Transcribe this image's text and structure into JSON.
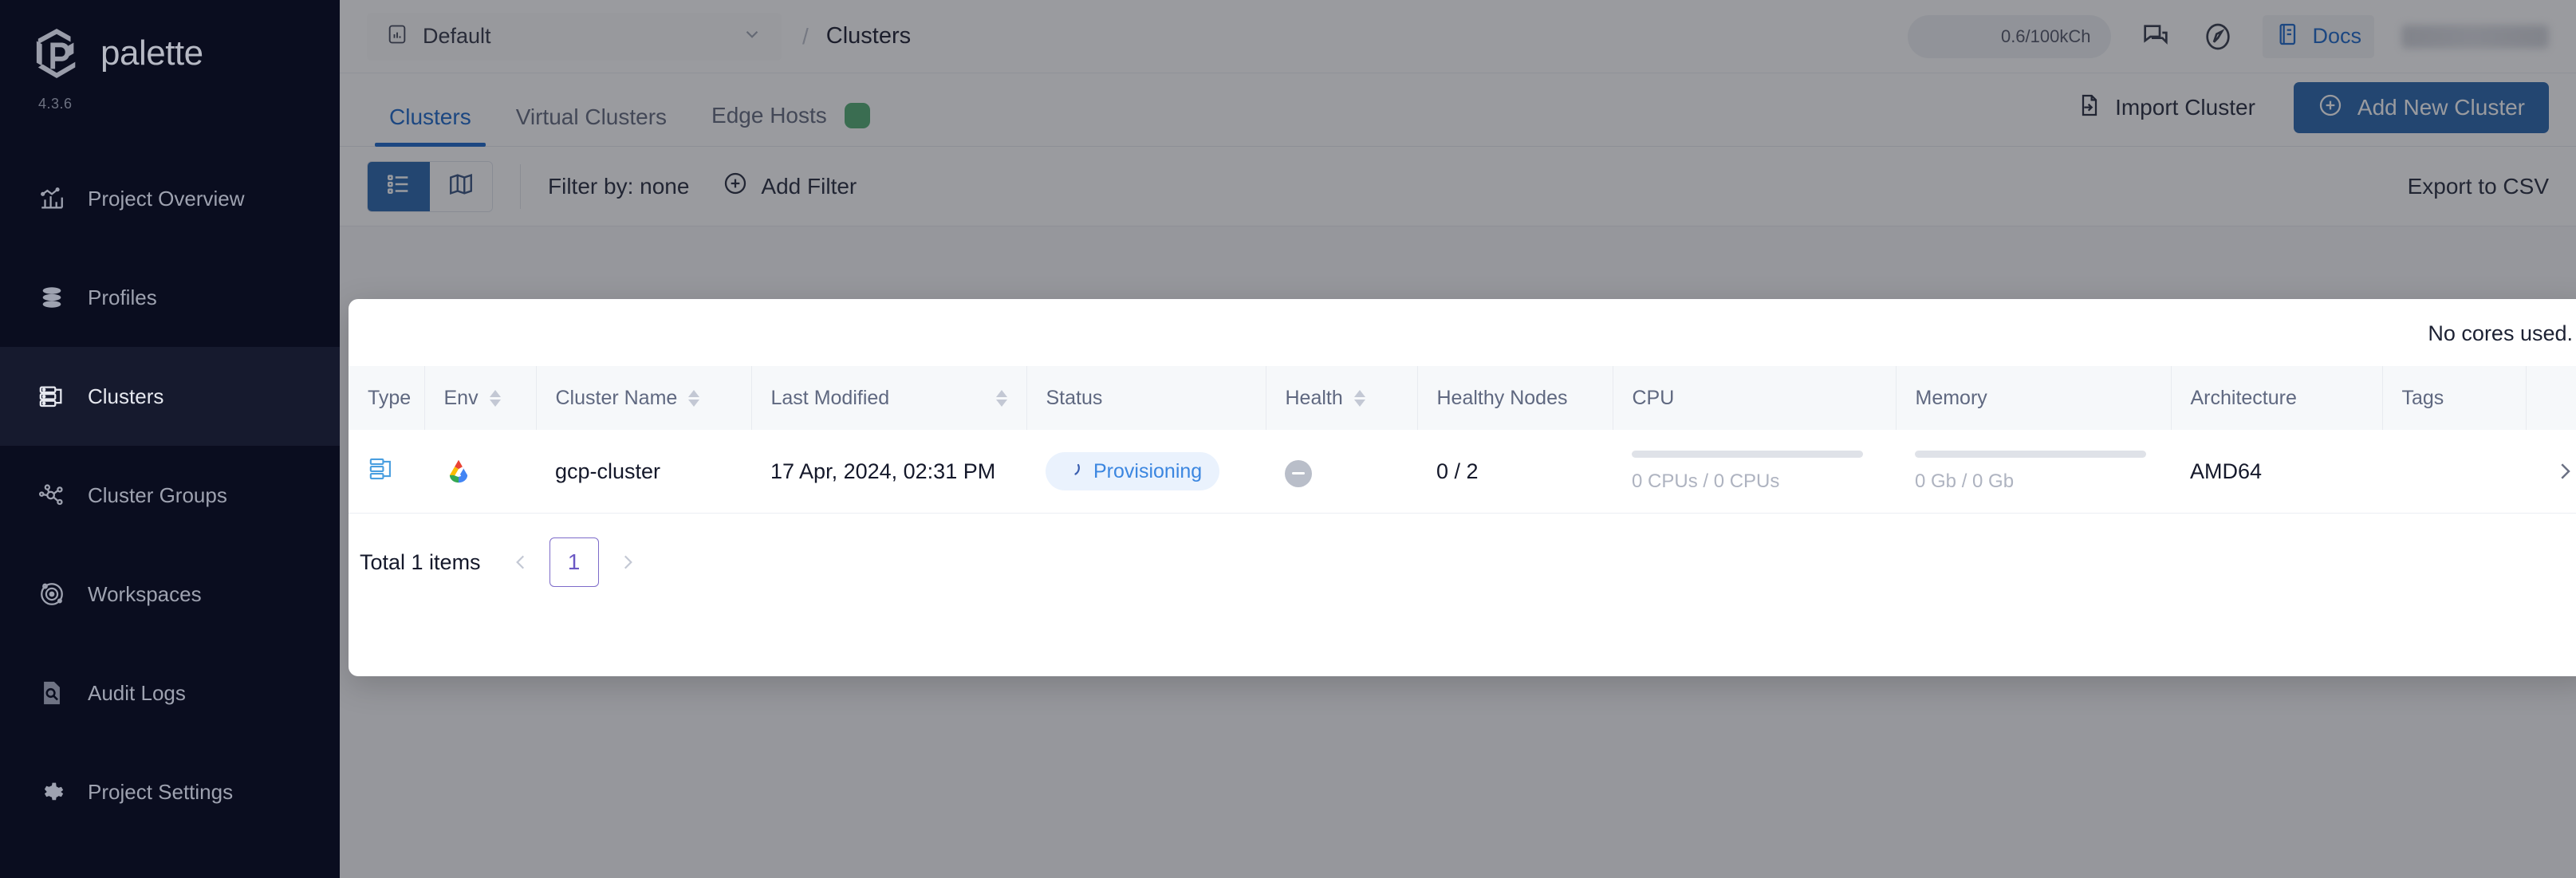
{
  "brand": {
    "name": "palette",
    "version": "4.3.6",
    "logo_icon": "palette-hexagon-logo"
  },
  "sidebar": {
    "items": [
      {
        "label": "Project Overview",
        "icon": "bar-chart-icon",
        "active": false
      },
      {
        "label": "Profiles",
        "icon": "layers-stack-icon",
        "active": false
      },
      {
        "label": "Clusters",
        "icon": "server-rack-icon",
        "active": true
      },
      {
        "label": "Cluster Groups",
        "icon": "network-nodes-icon",
        "active": false
      },
      {
        "label": "Workspaces",
        "icon": "orbit-icon",
        "active": false
      },
      {
        "label": "Audit Logs",
        "icon": "document-search-icon",
        "active": false
      },
      {
        "label": "Project Settings",
        "icon": "gear-icon",
        "active": false
      }
    ]
  },
  "topbar": {
    "project_icon": "chart-square-icon",
    "project_name": "Default",
    "chevron_icon": "chevron-down-icon",
    "breadcrumb_separator": "/",
    "breadcrumb_current": "Clusters",
    "usage_pill": "0.6/100kCh",
    "chat_icon": "chat-bubbles-icon",
    "compass_icon": "compass-icon",
    "docs_icon": "book-icon",
    "docs_label": "Docs",
    "user_name": ""
  },
  "tabs": [
    {
      "label": "Clusters",
      "active": true,
      "badge": false
    },
    {
      "label": "Virtual Clusters",
      "active": false,
      "badge": false
    },
    {
      "label": "Edge Hosts",
      "active": false,
      "badge": true
    }
  ],
  "actions": {
    "import_label": "Import Cluster",
    "import_icon": "file-import-icon",
    "add_label": "Add New Cluster",
    "add_icon": "plus-circle-icon"
  },
  "toolbar": {
    "list_view_icon": "list-view-icon",
    "map_view_icon": "map-view-icon",
    "filter_label": "Filter by: none",
    "add_filter_label": "Add Filter",
    "add_filter_icon": "plus-circle-icon",
    "export_label": "Export to CSV"
  },
  "panel": {
    "note": "No cores used.",
    "columns": [
      {
        "label": "Type",
        "sortable": false
      },
      {
        "label": "Env",
        "sortable": true
      },
      {
        "label": "Cluster Name",
        "sortable": true
      },
      {
        "label": "Last Modified",
        "sortable": true
      },
      {
        "label": "Status",
        "sortable": false
      },
      {
        "label": "Health",
        "sortable": true
      },
      {
        "label": "Healthy Nodes",
        "sortable": false
      },
      {
        "label": "CPU",
        "sortable": false
      },
      {
        "label": "Memory",
        "sortable": false
      },
      {
        "label": "Architecture",
        "sortable": false
      },
      {
        "label": "Tags",
        "sortable": false
      }
    ],
    "rows": [
      {
        "type_icon": "cluster-type-icon",
        "env_icon": "gcp-logo-icon",
        "name": "gcp-cluster",
        "last_modified": "17 Apr, 2024, 02:31 PM",
        "status": "Provisioning",
        "status_icon": "spinner-icon",
        "health_icon": "health-minus-icon",
        "healthy_nodes": "0 / 2",
        "cpu_text": "0 CPUs / 0 CPUs",
        "cpu_percent": 0,
        "memory_text": "0 Gb / 0 Gb",
        "memory_percent": 0,
        "architecture": "AMD64",
        "tags": "",
        "expand_icon": "chevron-right-icon"
      }
    ],
    "pagination": {
      "total_label": "Total 1 items",
      "prev_icon": "chevron-left-icon",
      "next_icon": "chevron-right-icon",
      "current_page": "1"
    }
  },
  "colors": {
    "sidebar_bg": "#0a0d1f",
    "accent_blue": "#1161c7",
    "primary_button": "#1f5fa8",
    "status_blue": "#3b86e0",
    "badge_green": "#4aa96c",
    "pagination_purple": "#6b58c4"
  }
}
